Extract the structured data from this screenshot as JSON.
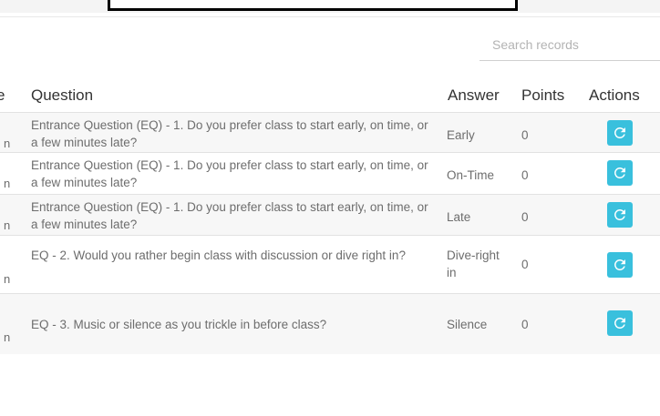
{
  "search": {
    "placeholder": "Search records"
  },
  "table": {
    "header_cut": "e",
    "columns": {
      "question": "Question",
      "answer": "Answer",
      "points": "Points",
      "actions": "Actions"
    },
    "rows": [
      {
        "cut": "n",
        "question": "Entrance Question (EQ) - 1. Do you prefer class to start early, on time, or a few minutes late?",
        "answer": "Early",
        "points": "0"
      },
      {
        "cut": "n",
        "question": "Entrance Question (EQ) - 1. Do you prefer class to start early, on time, or a few minutes late?",
        "answer": "On-Time",
        "points": "0"
      },
      {
        "cut": "n",
        "question": "Entrance Question (EQ) - 1. Do you prefer class to start early, on time, or a few minutes late?",
        "answer": "Late",
        "points": "0"
      },
      {
        "cut": "n",
        "question": "EQ - 2. Would you rather begin class with discussion or dive right in?",
        "answer": "Dive-right in",
        "points": "0"
      },
      {
        "cut": "n",
        "question": "EQ - 3. Music or silence as you trickle in before class?",
        "answer": "Silence",
        "points": "0"
      }
    ]
  },
  "icons": {
    "action": "refresh-icon"
  },
  "colors": {
    "action_button": "#39c0dd",
    "row_stripe": "#f7f7f7"
  }
}
